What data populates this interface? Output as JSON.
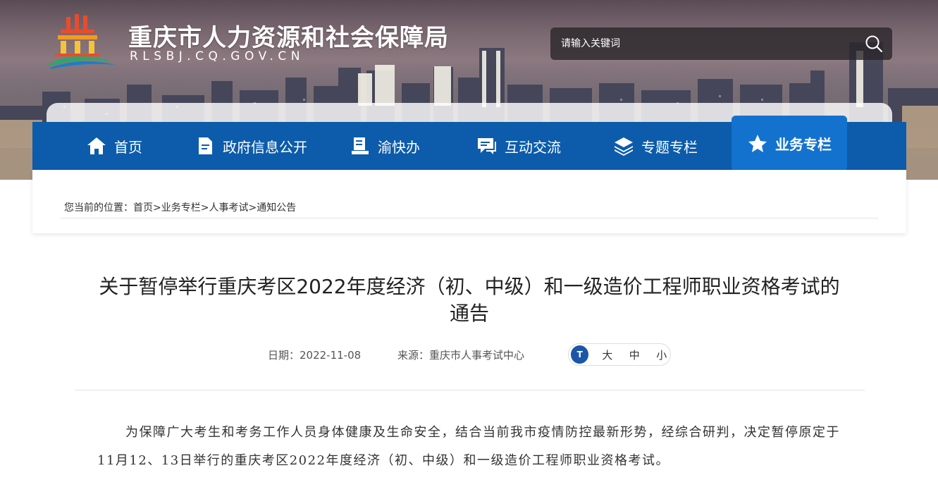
{
  "header": {
    "site_title": "重庆市人力资源和社会保障局",
    "site_domain": "RLSBJ.CQ.GOV.CN",
    "search": {
      "placeholder": "请输入关键词"
    }
  },
  "nav": {
    "items": [
      {
        "label": "首页",
        "icon": "home-icon"
      },
      {
        "label": "政府信息公开",
        "icon": "document-icon"
      },
      {
        "label": "渝快办",
        "icon": "service-desk-icon"
      },
      {
        "label": "互动交流",
        "icon": "chat-icon"
      },
      {
        "label": "专题专栏",
        "icon": "layers-icon"
      },
      {
        "label": "业务专栏",
        "icon": "star-icon",
        "active": true
      }
    ],
    "colors": {
      "bar": "#0c5cab",
      "active": "#1472cf"
    }
  },
  "breadcrumb": {
    "prefix": "您当前的位置：",
    "items": [
      "首页",
      "业务专栏",
      "人事考试",
      "通知公告"
    ],
    "separator": ">"
  },
  "article": {
    "title_line1": "关于暂停举行重庆考区2022年度经济（初、中级）和一级造价工程师职业资格考试的",
    "title_line2": "通告",
    "date_label": "日期：2022-11-08",
    "source_label": "来源：重庆市人事考试中心",
    "font_size": {
      "icon_text": "T",
      "large": "大",
      "medium": "中",
      "small": "小"
    },
    "body": "为保障广大考生和考务工作人员身体健康及生命安全，结合当前我市疫情防控最新形势，经综合研判，决定暂停原定于11月12、13日举行的重庆考区2022年度经济（初、中级）和一级造价工程师职业资格考试。"
  }
}
